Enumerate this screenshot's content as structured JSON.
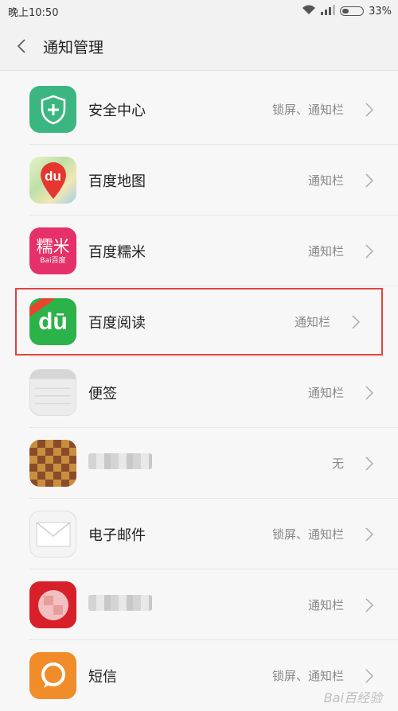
{
  "status_bar": {
    "time": "晚上10:50",
    "battery": "33%",
    "battery_level": 0.33
  },
  "header": {
    "title": "通知管理"
  },
  "apps": [
    {
      "name": "安全中心",
      "status": "锁屏、通知栏",
      "icon": "security-center-icon"
    },
    {
      "name": "百度地图",
      "status": "通知栏",
      "icon": "baidu-maps-icon"
    },
    {
      "name": "百度糯米",
      "status": "通知栏",
      "icon": "baidu-nuomi-icon"
    },
    {
      "name": "百度阅读",
      "status": "通知栏",
      "icon": "baidu-read-icon"
    },
    {
      "name": "便签",
      "status": "通知栏",
      "icon": "notes-icon"
    },
    {
      "name": "",
      "status": "无",
      "icon": "blurred-app-icon"
    },
    {
      "name": "电子邮件",
      "status": "锁屏、通知栏",
      "icon": "email-icon"
    },
    {
      "name": "",
      "status": "通知栏",
      "icon": "blurred-app-icon"
    },
    {
      "name": "短信",
      "status": "锁屏、通知栏",
      "icon": "sms-icon"
    }
  ],
  "icon_text": {
    "baidu_maps": "du",
    "baidu_nuomi": "糯米",
    "baidu_nuomi_sub": "Bai百度",
    "baidu_read": "dū"
  },
  "watermark": "Bai百经验",
  "colors": {
    "highlight": "#e0443c",
    "security_green": "#3bb681",
    "read_green": "#2bb34a",
    "sms_orange": "#f08c2a"
  }
}
